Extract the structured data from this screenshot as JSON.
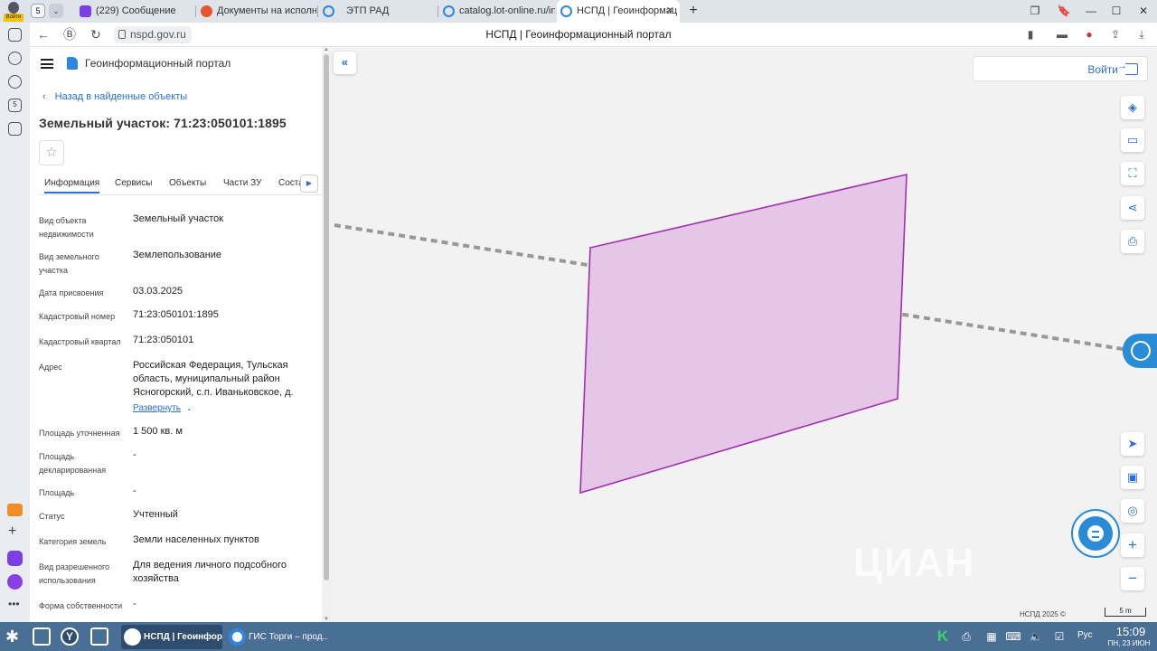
{
  "browser": {
    "profile_badge": "Войти",
    "tab_count": "5",
    "tabs": [
      {
        "title": "(229) Сообщение",
        "color": "#7b3fe4"
      },
      {
        "title": "Документы на исполнен",
        "color": "#e8542c"
      },
      {
        "title": "ЭТП РАД",
        "color": "#2e86e0"
      },
      {
        "title": "catalog.lot-online.ru/inde",
        "color": "#2e86e0"
      },
      {
        "title": "НСПД | Геоинформац",
        "color": "#2e86e0",
        "active": true
      }
    ],
    "new_tab_label": "+",
    "url": "nspd.gov.ru",
    "page_title": "НСПД | Геоинформационный портал"
  },
  "panel": {
    "portal_name": "Геоинформационный портал",
    "back_link": "Назад в найденные объекты",
    "title": "Земельный участок: 71:23:050101:1895",
    "tabs": [
      "Информация",
      "Сервисы",
      "Объекты",
      "Части ЗУ",
      "Состав"
    ],
    "active_tab": "Информация",
    "expand_link": "Развернуть",
    "fields": [
      {
        "label": "Вид объекта недвижимости",
        "value": "Земельный участок"
      },
      {
        "label": "Вид земельного участка",
        "value": "Землепользование"
      },
      {
        "label": "Дата присвоения",
        "value": "03.03.2025"
      },
      {
        "label": "Кадастровый номер",
        "value": "71:23:050101:1895"
      },
      {
        "label": "Кадастровый квартал",
        "value": "71:23:050101"
      },
      {
        "label": "Адрес",
        "value": "Российская Федерация, Тульская область, муниципальный район Ясногорский, с.п. Иваньковское, д."
      },
      {
        "label": "Площадь уточненная",
        "value": "1 500 кв. м"
      },
      {
        "label": "Площадь декларированная",
        "value": "-"
      },
      {
        "label": "Площадь",
        "value": "-"
      },
      {
        "label": "Статус",
        "value": "Учтенный"
      },
      {
        "label": "Категория земель",
        "value": "Земли населенных пунктов"
      },
      {
        "label": "Вид разрешенного использования",
        "value": "Для ведения личного подсобного хозяйства"
      },
      {
        "label": "Форма собственности",
        "value": "-"
      }
    ]
  },
  "map": {
    "login_label": "Войти",
    "copyright": "НСПД 2025 ©",
    "scale_label": "5 m",
    "parcel_fill": "#e6c6e6",
    "parcel_stroke": "#a12fb0",
    "accent": "#2a6fd6",
    "tools": [
      "layers-icon",
      "ruler-icon",
      "select-area-icon",
      "share-icon",
      "print-icon",
      "locate-icon",
      "minimap-icon",
      "geo-search-icon",
      "zoom-in-icon",
      "zoom-out-icon"
    ]
  },
  "taskbar": {
    "tasks": [
      {
        "title": "НСПД | Геоинфор...",
        "active": true
      },
      {
        "title": "ГИС Торги – прод...",
        "active": false
      }
    ],
    "lang": "Рус",
    "time": "15:09",
    "date": "ПН, 23 ИЮН"
  }
}
